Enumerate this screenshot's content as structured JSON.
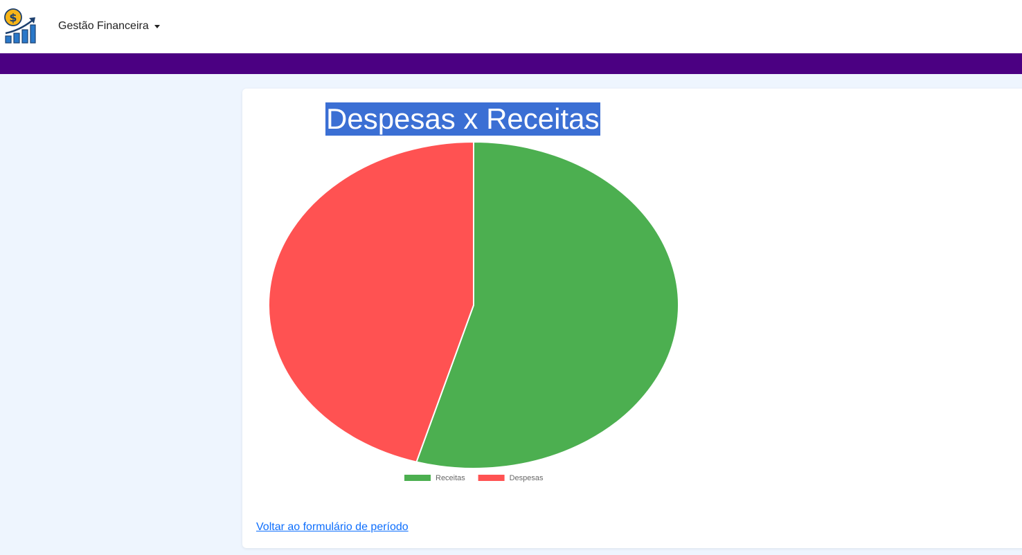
{
  "navbar": {
    "brand_menu_label": "Gestão Financeira",
    "logo_icon": "money-growth-chart-icon",
    "accent_color": "#4b0082"
  },
  "main": {
    "back_link_text": "Voltar ao formulário de período"
  },
  "chart_data": {
    "type": "pie",
    "title": "Despesas x Receitas",
    "labels": [
      "Receitas",
      "Despesas"
    ],
    "values": [
      54.5,
      45.5
    ],
    "colors": [
      "#4caf50",
      "#ff5252"
    ],
    "legend": "bottom"
  }
}
